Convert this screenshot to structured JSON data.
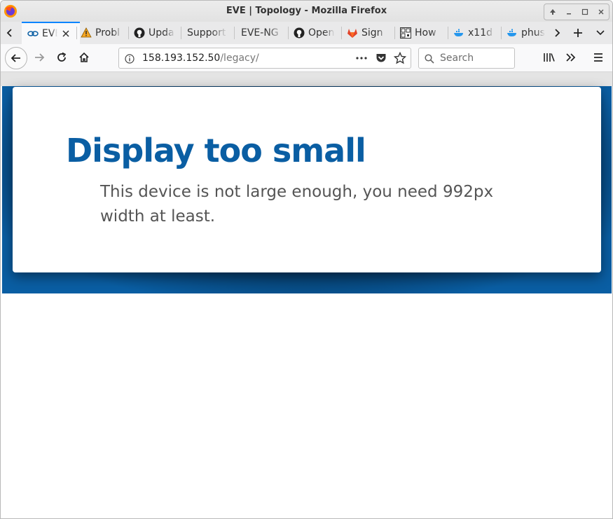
{
  "window": {
    "title": "EVE | Topology - Mozilla Firefox"
  },
  "tabs": [
    {
      "label": "EVE",
      "icon": "eve-icon",
      "active": true
    },
    {
      "label": "Probl",
      "icon": "warning-icon"
    },
    {
      "label": "Upda",
      "icon": "github-icon"
    },
    {
      "label": "Support",
      "icon": ""
    },
    {
      "label": "EVE-NG",
      "icon": ""
    },
    {
      "label": "Open",
      "icon": "github-icon"
    },
    {
      "label": "Sign",
      "icon": "gitlab-icon"
    },
    {
      "label": "How",
      "icon": "qr-icon"
    },
    {
      "label": "x11d",
      "icon": "docker-icon"
    },
    {
      "label": "phus",
      "icon": "docker-icon"
    }
  ],
  "navbar": {
    "url_host": "158.193.152.50",
    "url_path": "/legacy/",
    "search_placeholder": "Search"
  },
  "page": {
    "heading": "Display too small",
    "message": "This device is not large enough, you need 992px width at least."
  },
  "colors": {
    "accent": "#0a84ff",
    "brand_blue": "#0a5ea3",
    "text_gray": "#555555"
  }
}
